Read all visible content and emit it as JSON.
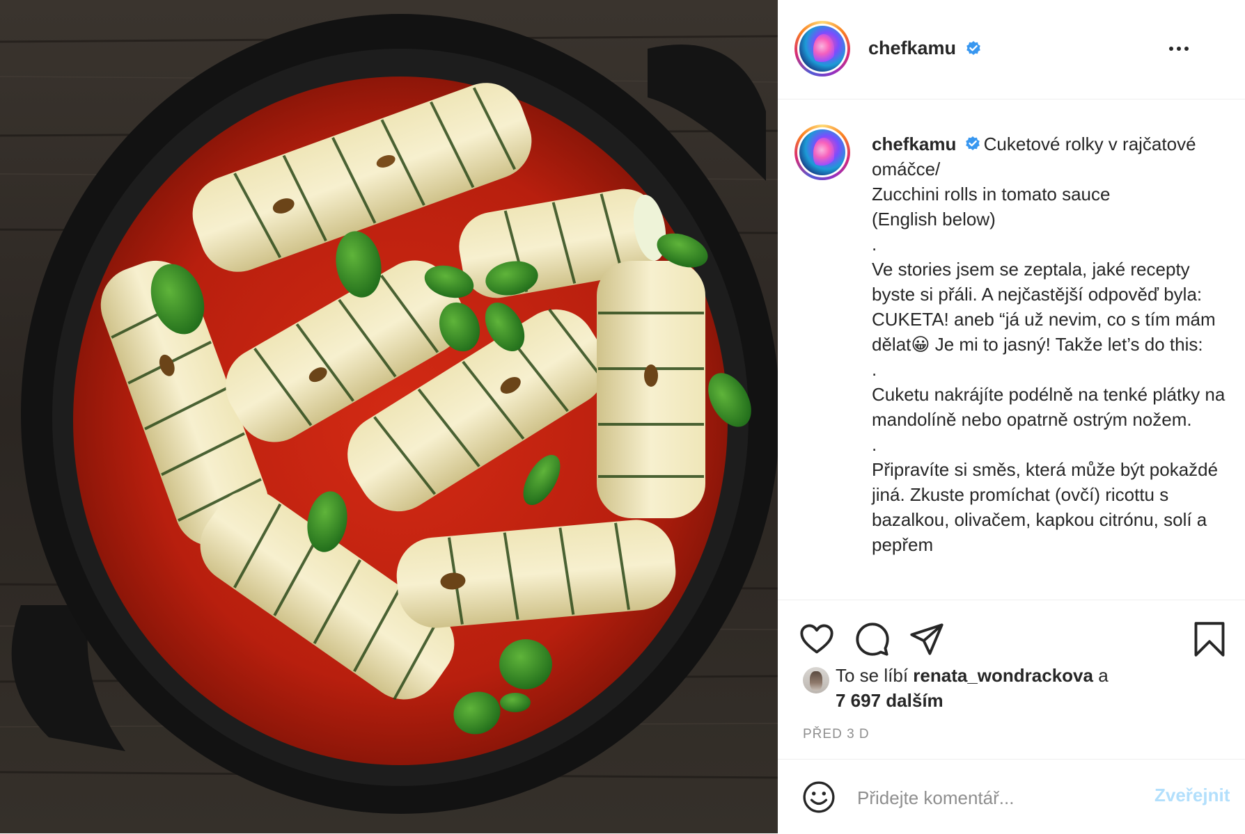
{
  "post": {
    "author": {
      "username": "chefkamu",
      "verified": true
    },
    "caption": {
      "username": "chefkamu",
      "text": "Cuketové rolky v rajčatové omáčce/\nZucchini rolls in tomato sauce\n(English below)\n.\nVe stories jsem se zeptala, jaké recepty byste si přáli. A nejčastější odpověď byla: CUKETA! aneb “já už nevim, co s tím mám dělat😀 Je mi to jasný! Takže let’s do this:\n.\nCuketu nakrájíte podélně na tenké plátky na mandolíně nebo opatrně ostrým nožem.\n.\nPřipravíte si směs, která může být pokaždé jiná. Zkuste promíchat (ovčí) ricottu s bazalkou, olivačem, kapkou citrónu, solí a pepřem"
    },
    "actions": {
      "like_icon": "heart-icon",
      "comment_icon": "comment-icon",
      "share_icon": "paper-plane-icon",
      "save_icon": "bookmark-icon"
    },
    "likes": {
      "prefix": "To se líbí",
      "user": "renata_wondrackova",
      "connector": "a",
      "others": "7 697 dalším"
    },
    "timestamp": "PŘED 3 D",
    "comment_box": {
      "emoji_icon": "smiley-icon",
      "placeholder": "Přidejte komentář...",
      "post_label": "Zveřejnit"
    },
    "colors": {
      "text": "#262626",
      "secondary_text": "#8e8e8e",
      "verified_blue": "#3897f0",
      "post_button_disabled": "#b2dffc",
      "divider": "#efefef"
    }
  }
}
